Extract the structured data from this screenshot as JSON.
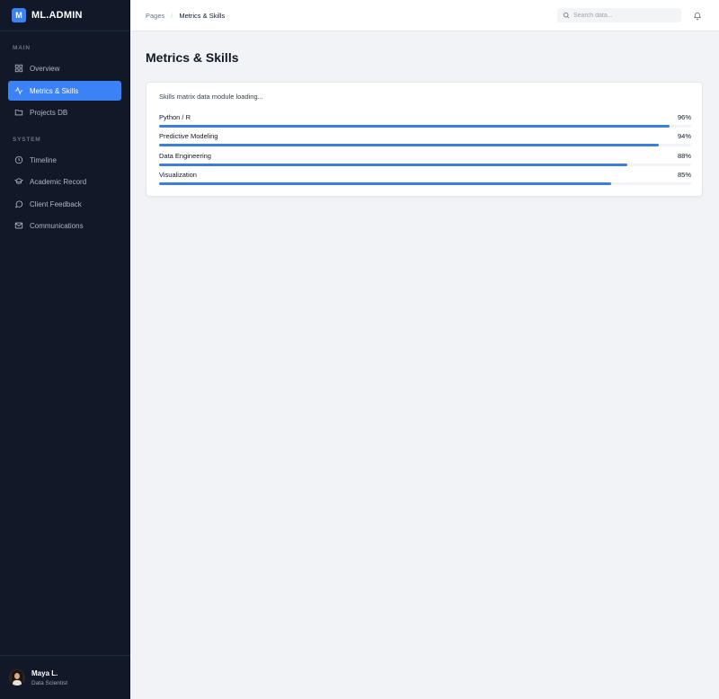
{
  "brand": {
    "logo_letter": "M",
    "name": "ML.ADMIN",
    "accent": "#3b82f6"
  },
  "sidebar": {
    "sections": [
      {
        "label": "MAIN"
      },
      {
        "label": "SYSTEM"
      }
    ],
    "items": [
      {
        "label": "Overview",
        "icon": "grid-icon"
      },
      {
        "label": "Metrics & Skills",
        "icon": "activity-icon",
        "active": true
      },
      {
        "label": "Projects DB",
        "icon": "folder-icon"
      },
      {
        "label": "Timeline",
        "icon": "clock-icon"
      },
      {
        "label": "Academic Record",
        "icon": "graduation-cap-icon"
      },
      {
        "label": "Client Feedback",
        "icon": "message-circle-icon"
      },
      {
        "label": "Communications",
        "icon": "mail-icon"
      }
    ],
    "user": {
      "name": "Maya L.",
      "role": "Data Scientist"
    }
  },
  "topbar": {
    "breadcrumb": {
      "parent": "Pages",
      "current": "Metrics & Skills"
    },
    "search": {
      "placeholder": "Search data...",
      "value": ""
    }
  },
  "main": {
    "title": "Metrics & Skills",
    "status": "Skills matrix data module loading...",
    "skills": [
      {
        "name": "Python / R",
        "percent": "96%",
        "value": 96
      },
      {
        "name": "Predictive Modeling",
        "percent": "94%",
        "value": 94
      },
      {
        "name": "Data Engineering",
        "percent": "88%",
        "value": 88
      },
      {
        "name": "Visualization",
        "percent": "85%",
        "value": 85
      }
    ]
  }
}
